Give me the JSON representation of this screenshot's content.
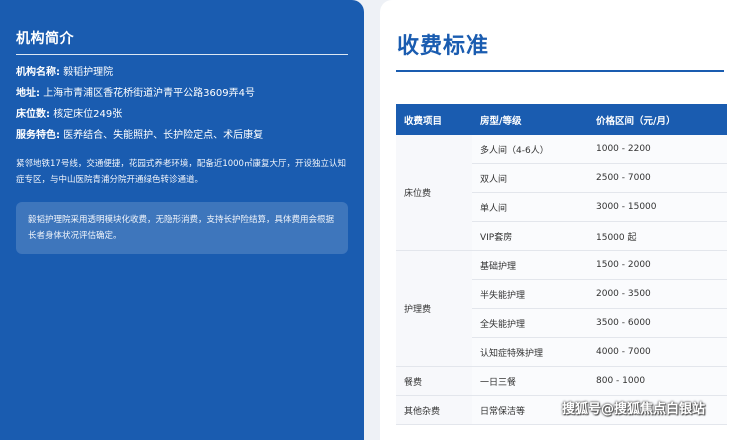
{
  "intro": {
    "title": "机构简介",
    "rows": [
      {
        "label": "机构名称:",
        "value": "毅韬护理院"
      },
      {
        "label": "地址:",
        "value": "上海市青浦区香花桥街道沪青平公路3609弄4号"
      },
      {
        "label": "床位数:",
        "value": "核定床位249张"
      },
      {
        "label": "服务特色:",
        "value": "医养结合、失能照护、长护险定点、术后康复"
      }
    ],
    "description": "紧邻地铁17号线，交通便捷，花园式养老环境，配备近1000㎡康复大厅，开设独立认知症专区，与中山医院青浦分院开通绿色转诊通道。",
    "note": "毅韬护理院采用透明模块化收费，无隐形消费，支持长护险结算，具体费用会根据长者身体状况评估确定。"
  },
  "fees": {
    "title": "收费标准",
    "headers": {
      "category": "收费项目",
      "type": "房型/等级",
      "price": "价格区间（元/月）"
    },
    "groups": [
      {
        "category": "床位费",
        "items": [
          {
            "type": "多人间（4-6人）",
            "price": "1000 - 2200"
          },
          {
            "type": "双人间",
            "price": "2500 - 7000"
          },
          {
            "type": "单人间",
            "price": "3000 - 15000"
          },
          {
            "type": "VIP套房",
            "price": "15000 起"
          }
        ]
      },
      {
        "category": "护理费",
        "items": [
          {
            "type": "基础护理",
            "price": "1500 - 2000"
          },
          {
            "type": "半失能护理",
            "price": "2000 - 3500"
          },
          {
            "type": "全失能护理",
            "price": "3500 - 6000"
          },
          {
            "type": "认知症特殊护理",
            "price": "4000 - 7000"
          }
        ]
      },
      {
        "category": "餐费",
        "items": [
          {
            "type": "一日三餐",
            "price": "800 - 1000"
          }
        ]
      },
      {
        "category": "其他杂费",
        "items": [
          {
            "type": "日常保洁等",
            "price": ""
          }
        ]
      }
    ]
  },
  "watermark": "搜狐号@搜狐焦点白银站",
  "colors": {
    "brand": "#1a5cb0",
    "page": "#eef1f6"
  }
}
